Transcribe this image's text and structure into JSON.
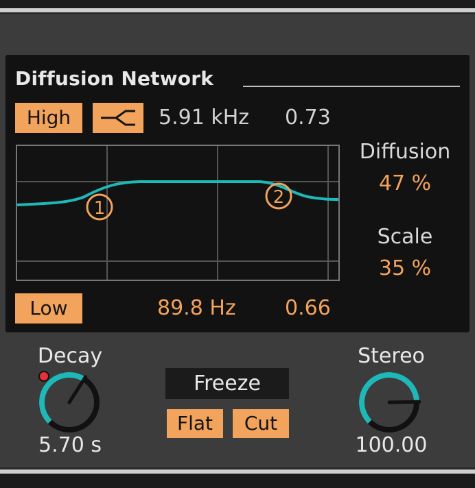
{
  "section_title": "Diffusion Network",
  "high": {
    "label": "High",
    "filter_shape_icon": "high-shelf-filter-icon",
    "frequency": "5.91 kHz",
    "q": "0.73"
  },
  "low": {
    "label": "Low",
    "frequency": "89.8 Hz",
    "q": "0.66"
  },
  "graph": {
    "handle_1_label": "1",
    "handle_2_label": "2"
  },
  "diffusion": {
    "label": "Diffusion",
    "value": "47 %"
  },
  "scale": {
    "label": "Scale",
    "value": "35 %"
  },
  "decay": {
    "label": "Decay",
    "value": "5.70 s",
    "level": 0.62
  },
  "freeze": {
    "label": "Freeze"
  },
  "flat": {
    "label": "Flat"
  },
  "cut": {
    "label": "Cut"
  },
  "stereo": {
    "label": "Stereo",
    "value": "100.00",
    "level": 0.83
  },
  "colors": {
    "accent_orange": "#f2a35c",
    "curve_teal": "#1fb8b8",
    "panel_bg": "#121212",
    "device_bg": "#3c3c3c",
    "indicator_red": "#e8303a"
  }
}
